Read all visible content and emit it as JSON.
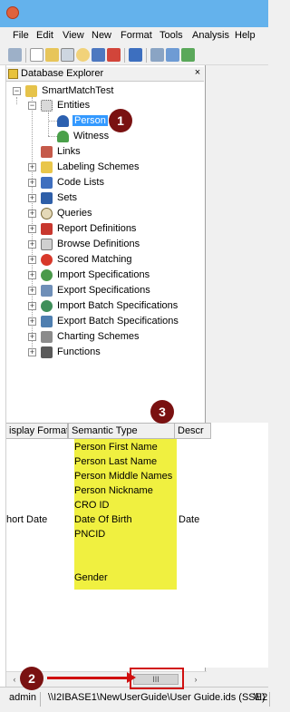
{
  "menu": [
    "File",
    "Edit",
    "View",
    "New",
    "Format",
    "Tools",
    "Analysis",
    "Help"
  ],
  "panel": {
    "title": "Database Explorer",
    "close": "×"
  },
  "tree": {
    "root": "SmartMatchTest",
    "entities": "Entities",
    "person": "Person",
    "witness": "Witness",
    "items": [
      "Links",
      "Labeling Schemes",
      "Code Lists",
      "Sets",
      "Queries",
      "Report Definitions",
      "Browse Definitions",
      "Scored Matching",
      "Import Specifications",
      "Export Specifications",
      "Import Batch Specifications",
      "Export Batch Specifications",
      "Charting Schemes",
      "Functions"
    ]
  },
  "grid": {
    "headers": [
      "isplay Format",
      "Semantic Type",
      "Descr"
    ],
    "display_format": "hort Date",
    "semantic_types": [
      "Person First Name",
      "Person Last Name",
      "Person Middle Names",
      "Person Nickname",
      "CRO ID",
      "Date Of Birth",
      "PNCID",
      "",
      "Gender"
    ],
    "descr": "Date"
  },
  "scrollbar": {
    "left": "‹",
    "right": "›",
    "thumb": "III"
  },
  "status": {
    "user": "admin",
    "path": "\\\\I2IBASE1\\NewUserGuide\\User Guide.ids (SSE)",
    "path2": "\\\\I2"
  },
  "callouts": [
    "1",
    "2",
    "3"
  ],
  "colors": {
    "highlight": "#f0f040",
    "selection": "#3399ff",
    "callout": "#7a1111",
    "annotation": "#d01010"
  }
}
